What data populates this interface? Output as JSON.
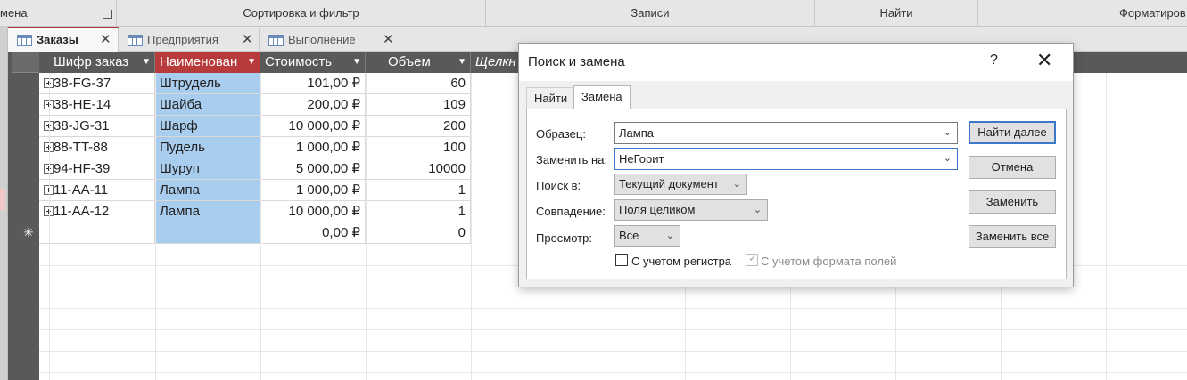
{
  "ribbon": {
    "groups": [
      "мена",
      "Сортировка и фильтр",
      "Записи",
      "Найти",
      "Форматиров"
    ]
  },
  "tabs": [
    {
      "label": "Заказы",
      "active": true
    },
    {
      "label": "Предприятия",
      "active": false
    },
    {
      "label": "Выполнение",
      "active": false
    }
  ],
  "tab_close_glyph": "✕",
  "table": {
    "columns": [
      "Шифр заказ",
      "Наименован",
      "Стоимость",
      "Объем",
      "Щелкн"
    ],
    "rows": [
      [
        "38-FG-37",
        "Штрудель",
        "101,00 ₽",
        "60"
      ],
      [
        "38-HE-14",
        "Шайба",
        "200,00 ₽",
        "109"
      ],
      [
        "38-JG-31",
        "Шарф",
        "10 000,00 ₽",
        "200"
      ],
      [
        "88-TT-88",
        "Пудель",
        "1 000,00 ₽",
        "100"
      ],
      [
        "94-HF-39",
        "Шуруп",
        "5 000,00 ₽",
        "10000"
      ],
      [
        "11-AA-11",
        "Лампа",
        "1 000,00 ₽",
        "1"
      ],
      [
        "11-AA-12",
        "Лампа",
        "10 000,00 ₽",
        "1"
      ]
    ],
    "new_row": [
      "",
      "",
      "0,00 ₽",
      "0"
    ],
    "new_row_glyph": "✳"
  },
  "dialog": {
    "title": "Поиск и замена",
    "help": "?",
    "close": "✕",
    "tabs": [
      "Найти",
      "Замена"
    ],
    "find_label": "Образец:",
    "find_value": "Лампа",
    "replace_label": "Заменить на:",
    "replace_value": "НеГорит",
    "look_in_label": "Поиск в:",
    "look_in_value": "Текущий документ",
    "match_label": "Совпадение:",
    "match_value": "Поля целиком",
    "search_label": "Просмотр:",
    "search_value": "Все",
    "match_case_label": "С учетом регистра",
    "match_case_checked": false,
    "search_format_label": "С учетом формата полей",
    "search_format_checked": true,
    "check_glyph": "✓",
    "buttons": {
      "find_next": "Найти далее",
      "cancel": "Отмена",
      "replace": "Заменить",
      "replace_all": "Заменить все"
    }
  },
  "colors": {
    "header_bg": "#595959",
    "selected_column_header": "#b83b3b",
    "selected_column_cells": "#a9cdee",
    "active_tab_accent": "#a4373a",
    "default_button_border": "#3c78c8"
  }
}
